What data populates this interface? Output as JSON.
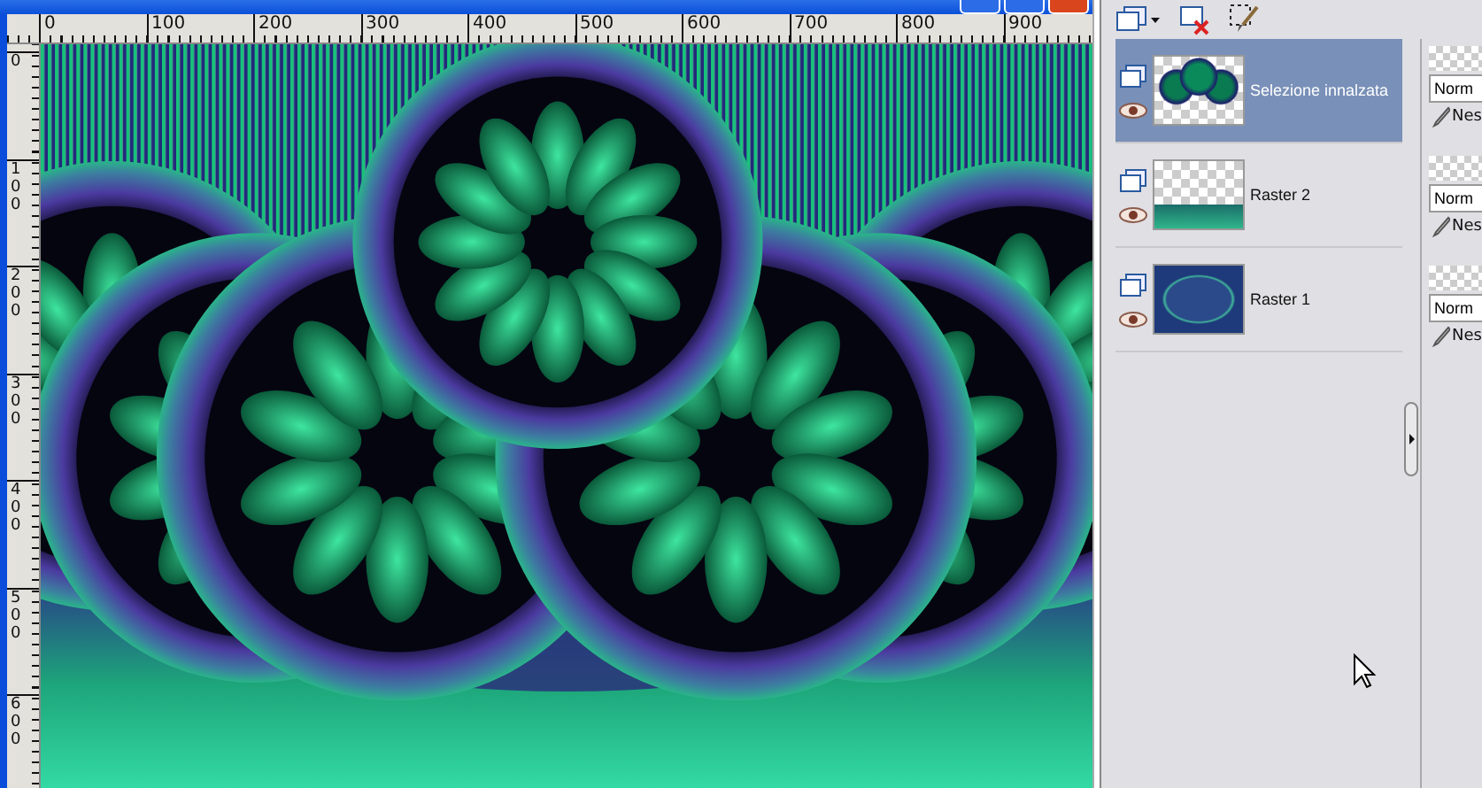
{
  "horizontal_ruler": {
    "labels": [
      "0",
      "100",
      "200",
      "300",
      "400",
      "500",
      "600",
      "700",
      "800",
      "900"
    ]
  },
  "vertical_ruler": {
    "labels": [
      "0",
      "100",
      "200",
      "300",
      "400",
      "500",
      "600"
    ]
  },
  "layers": [
    {
      "name": "Selezione innalzata",
      "selected": true,
      "kind": "flowers"
    },
    {
      "name": "Raster 2",
      "selected": false,
      "kind": "floor"
    },
    {
      "name": "Raster 1",
      "selected": false,
      "kind": "oval"
    }
  ],
  "layer_properties": [
    {
      "mode": "Norm",
      "blend": "Nes"
    },
    {
      "mode": "Norm",
      "blend": "Nes"
    },
    {
      "mode": "Norm",
      "blend": "Nes"
    }
  ]
}
